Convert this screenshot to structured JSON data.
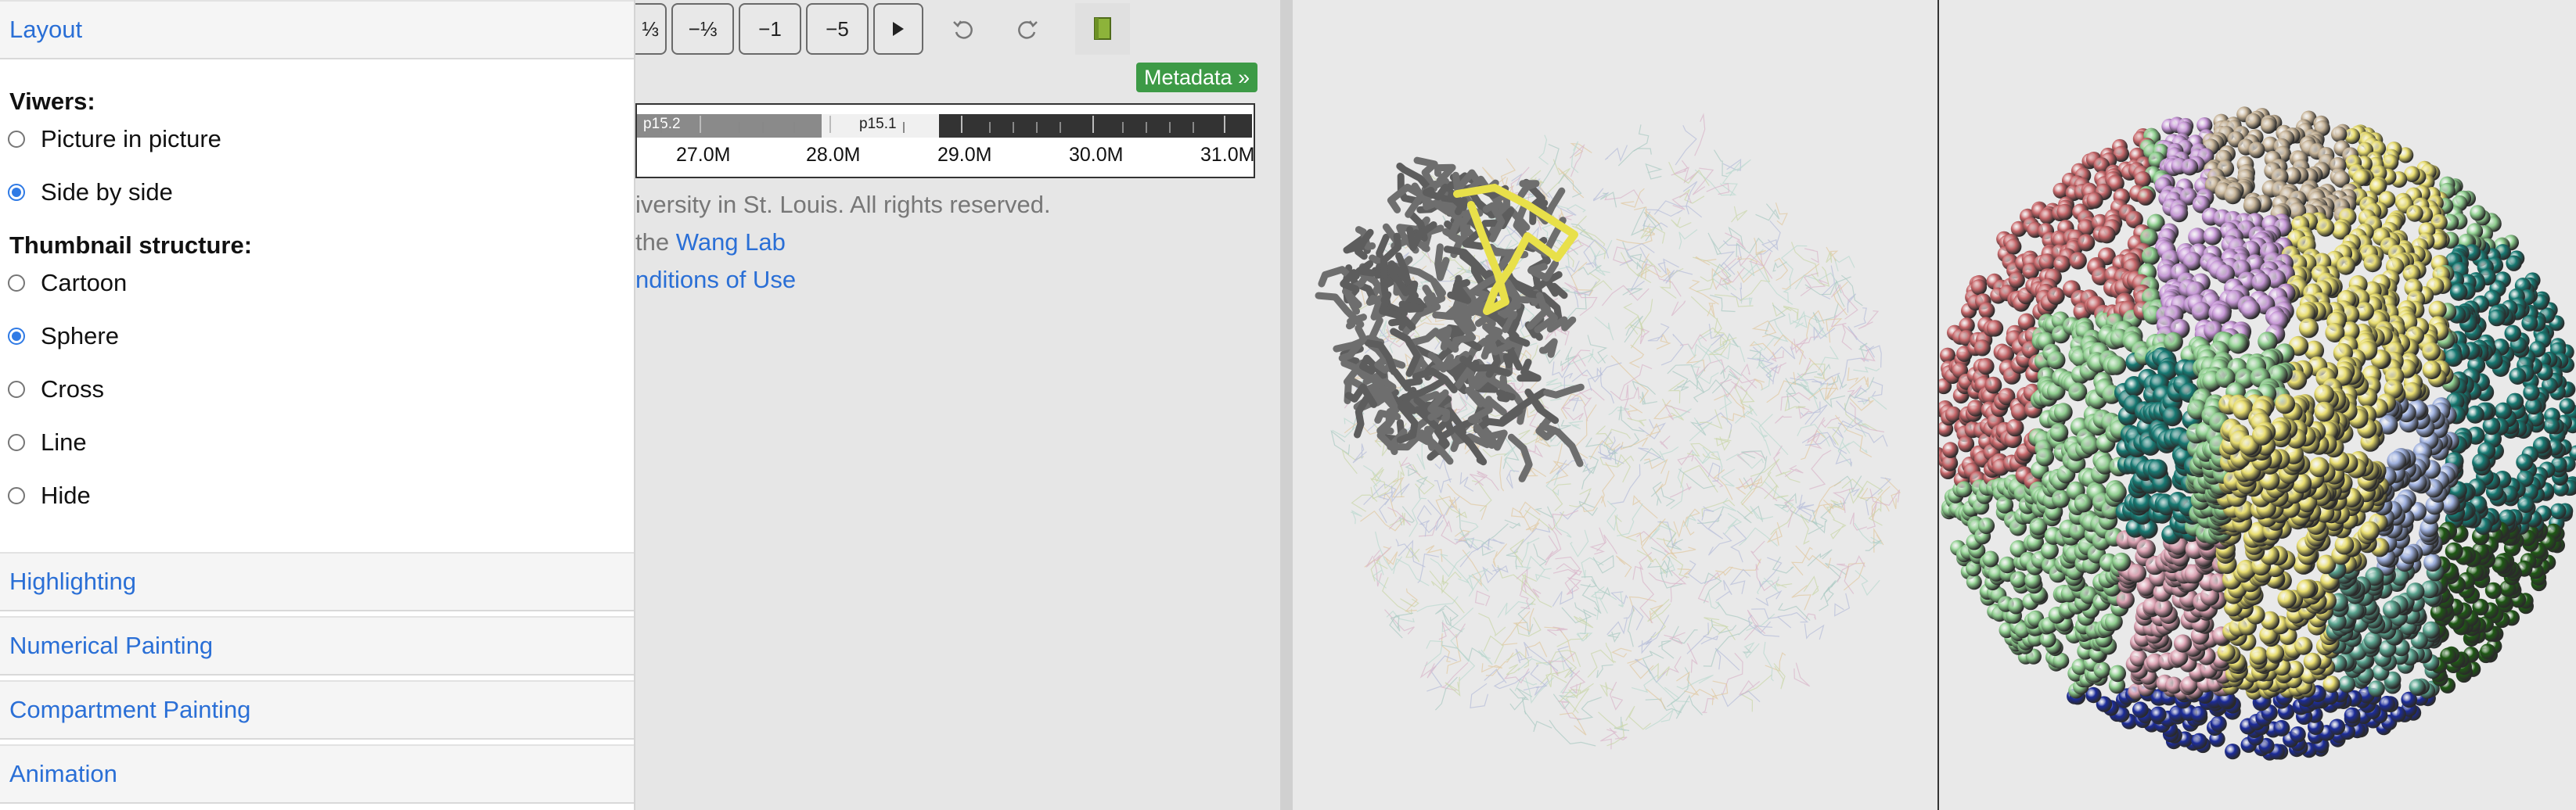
{
  "panel": {
    "layout_title": "Layout",
    "viewers_label": "Viwers:",
    "viewer_options": [
      {
        "label": "Picture in picture",
        "checked": false
      },
      {
        "label": "Side by side",
        "checked": true
      }
    ],
    "thumb_label": "Thumbnail structure:",
    "thumb_options": [
      {
        "label": "Cartoon",
        "checked": false
      },
      {
        "label": "Sphere",
        "checked": true
      },
      {
        "label": "Cross",
        "checked": false
      },
      {
        "label": "Line",
        "checked": false
      },
      {
        "label": "Hide",
        "checked": false
      }
    ],
    "sections": [
      "Highlighting",
      "Numerical Painting",
      "Compartment Painting",
      "Animation"
    ]
  },
  "toolbar": {
    "buttons": [
      "⅓",
      "−⅓",
      "−1",
      "−5"
    ],
    "play_icon": "play-icon",
    "undo_icon": "undo-icon",
    "redo_icon": "redo-icon",
    "book_icon": "book-icon"
  },
  "metadata_button": "Metadata »",
  "ideogram": {
    "bands": [
      "p15.2",
      "p15.1"
    ],
    "axis_labels": [
      "27.0M",
      "28.0M",
      "29.0M",
      "30.0M",
      "31.0M"
    ]
  },
  "footer": {
    "copyright": "iversity in St. Louis. All rights reserved.",
    "wang_prefix": "the ",
    "wang_link": "Wang Lab",
    "terms_link": "nditions of Use"
  },
  "colors": {
    "link": "#2a6fd6",
    "radio_checked": "#2f7ae5",
    "metadata_bg": "#3d9a46",
    "highlight_yellow": "#e8e04a",
    "gray_tube": "#5d5d5d"
  }
}
